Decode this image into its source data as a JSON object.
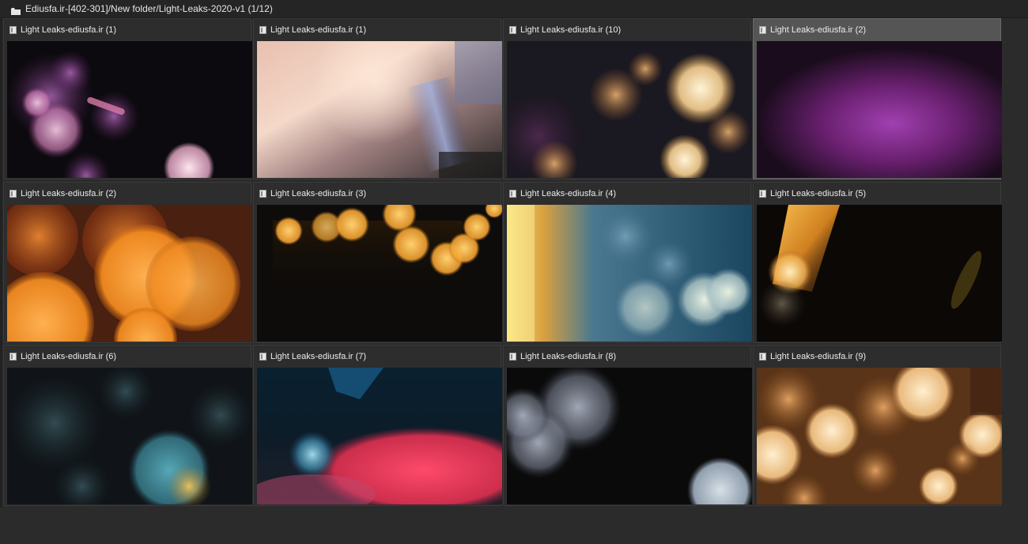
{
  "window": {
    "title": "Ediusfa.ir-[402-301]/New folder/Light-Leaks-2020-v1 (1/12)",
    "folder_icon": "folder-icon"
  },
  "clips": [
    {
      "label": "Light Leaks-ediusfa.ir (1)",
      "icon": "clip-icon",
      "selected": false
    },
    {
      "label": "Light Leaks-ediusfa.ir (1)",
      "icon": "clip-icon",
      "selected": false
    },
    {
      "label": "Light Leaks-ediusfa.ir (10)",
      "icon": "clip-icon",
      "selected": false
    },
    {
      "label": "Light Leaks-ediusfa.ir (2)",
      "icon": "clip-icon",
      "selected": true
    },
    {
      "label": "Light Leaks-ediusfa.ir (2)",
      "icon": "clip-icon",
      "selected": false
    },
    {
      "label": "Light Leaks-ediusfa.ir (3)",
      "icon": "clip-icon",
      "selected": false
    },
    {
      "label": "Light Leaks-ediusfa.ir (4)",
      "icon": "clip-icon",
      "selected": false
    },
    {
      "label": "Light Leaks-ediusfa.ir (5)",
      "icon": "clip-icon",
      "selected": false
    },
    {
      "label": "Light Leaks-ediusfa.ir (6)",
      "icon": "clip-icon",
      "selected": false
    },
    {
      "label": "Light Leaks-ediusfa.ir (7)",
      "icon": "clip-icon",
      "selected": false
    },
    {
      "label": "Light Leaks-ediusfa.ir (8)",
      "icon": "clip-icon",
      "selected": false
    },
    {
      "label": "Light Leaks-ediusfa.ir (9)",
      "icon": "clip-icon",
      "selected": false
    }
  ],
  "colors": {
    "background": "#2b2b2b",
    "cell_background": "#2d2d2d",
    "selected_background": "#555555",
    "text": "#ececec"
  }
}
